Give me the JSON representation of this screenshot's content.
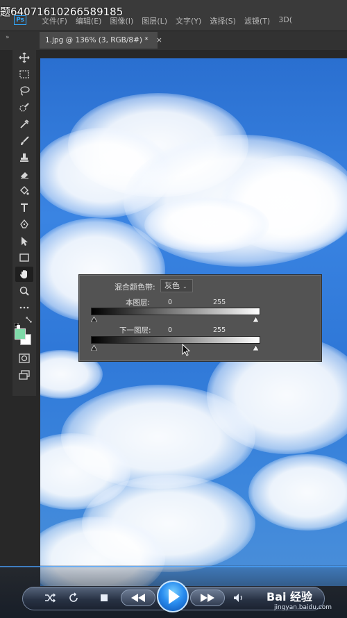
{
  "video": {
    "title_overlay": "题640716102665891 85",
    "title_text": "题64071610266589185"
  },
  "app": {
    "logo_text": "Ps",
    "menus": [
      "文件(F)",
      "编辑(E)",
      "图像(I)",
      "图层(L)",
      "文字(Y)",
      "选择(S)",
      "滤镜(T)",
      "3D("
    ]
  },
  "document": {
    "tab_label": "1.jpg @ 136% (3, RGB/8#) *",
    "close_glyph": "×"
  },
  "toolbar": {
    "collapse_glyph": "»",
    "foreground_color": "#7fd9a8",
    "background_color": "#ffffff",
    "tools": [
      "move-tool",
      "marquee-tool",
      "lasso-tool",
      "quick-select-tool",
      "eyedropper-tool",
      "brush-tool",
      "stamp-tool",
      "eraser-tool",
      "paint-bucket-tool",
      "type-tool",
      "pen-tool",
      "path-select-tool",
      "rectangle-tool",
      "hand-tool",
      "zoom-tool",
      "more-tools",
      "quick-mask",
      "screen-mode"
    ],
    "active_tool": "hand-tool"
  },
  "blend_if": {
    "label": "混合颜色带:",
    "channel": "灰色",
    "this_layer": {
      "label": "本图层:",
      "black_value": "0",
      "white_value": "255"
    },
    "underlying_layer": {
      "label": "下一图层:",
      "black_value": "0",
      "white_value": "255"
    }
  },
  "player": {
    "watermark": "Bai 经验",
    "watermark_sub": "jingyan.baidu.com",
    "accent": "#2a8ef0"
  }
}
